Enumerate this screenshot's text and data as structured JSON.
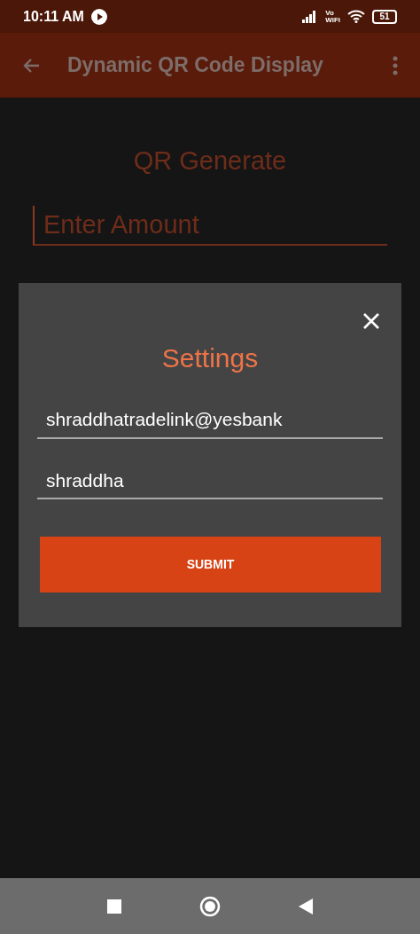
{
  "status_bar": {
    "time": "10:11 AM",
    "vowifi": [
      "Vo",
      "WiFi"
    ],
    "battery": "51"
  },
  "app_bar": {
    "title": "Dynamic QR Code Display"
  },
  "screen": {
    "heading": "QR Generate",
    "amount_field": {
      "placeholder": "Enter Amount",
      "focused": true
    }
  },
  "dialog": {
    "title": "Settings",
    "fields": [
      {
        "value": "shraddhatradelink@yesbank"
      },
      {
        "value": "shraddha"
      }
    ],
    "submit": "SUBMIT"
  }
}
